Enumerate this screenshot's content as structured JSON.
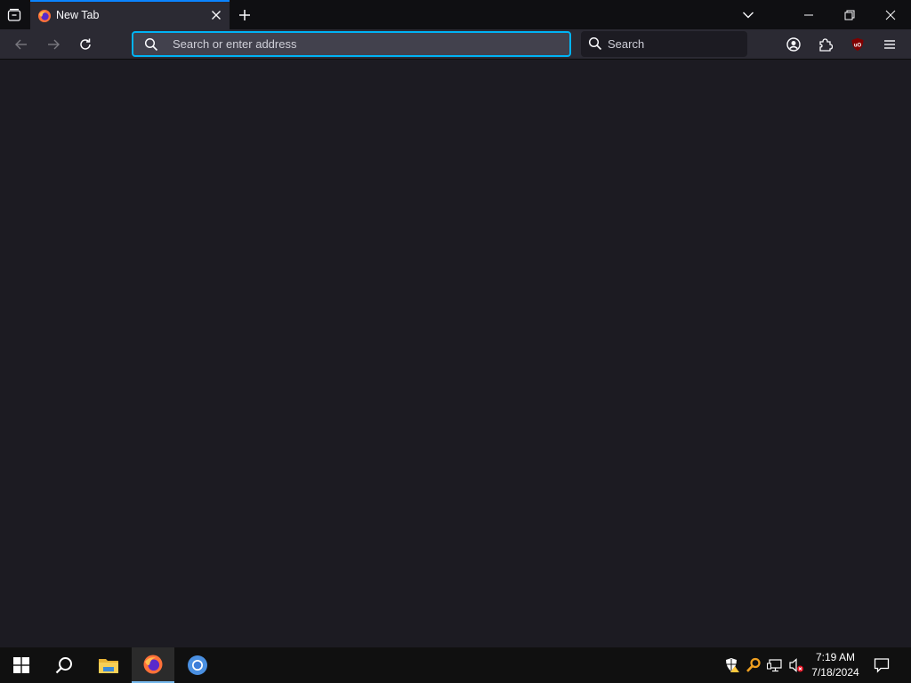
{
  "tab": {
    "title": "New Tab"
  },
  "urlbar": {
    "placeholder": "Search or enter address"
  },
  "searchbar": {
    "placeholder": "Search"
  },
  "extensions": {
    "ublock_label": "uO"
  },
  "taskbar": {
    "time": "7:19 AM",
    "date": "7/18/2024"
  },
  "colors": {
    "accent": "#00b3f4",
    "tab_top": "#0a84ff",
    "background": "#1c1b22",
    "ublock_red": "#800000"
  }
}
